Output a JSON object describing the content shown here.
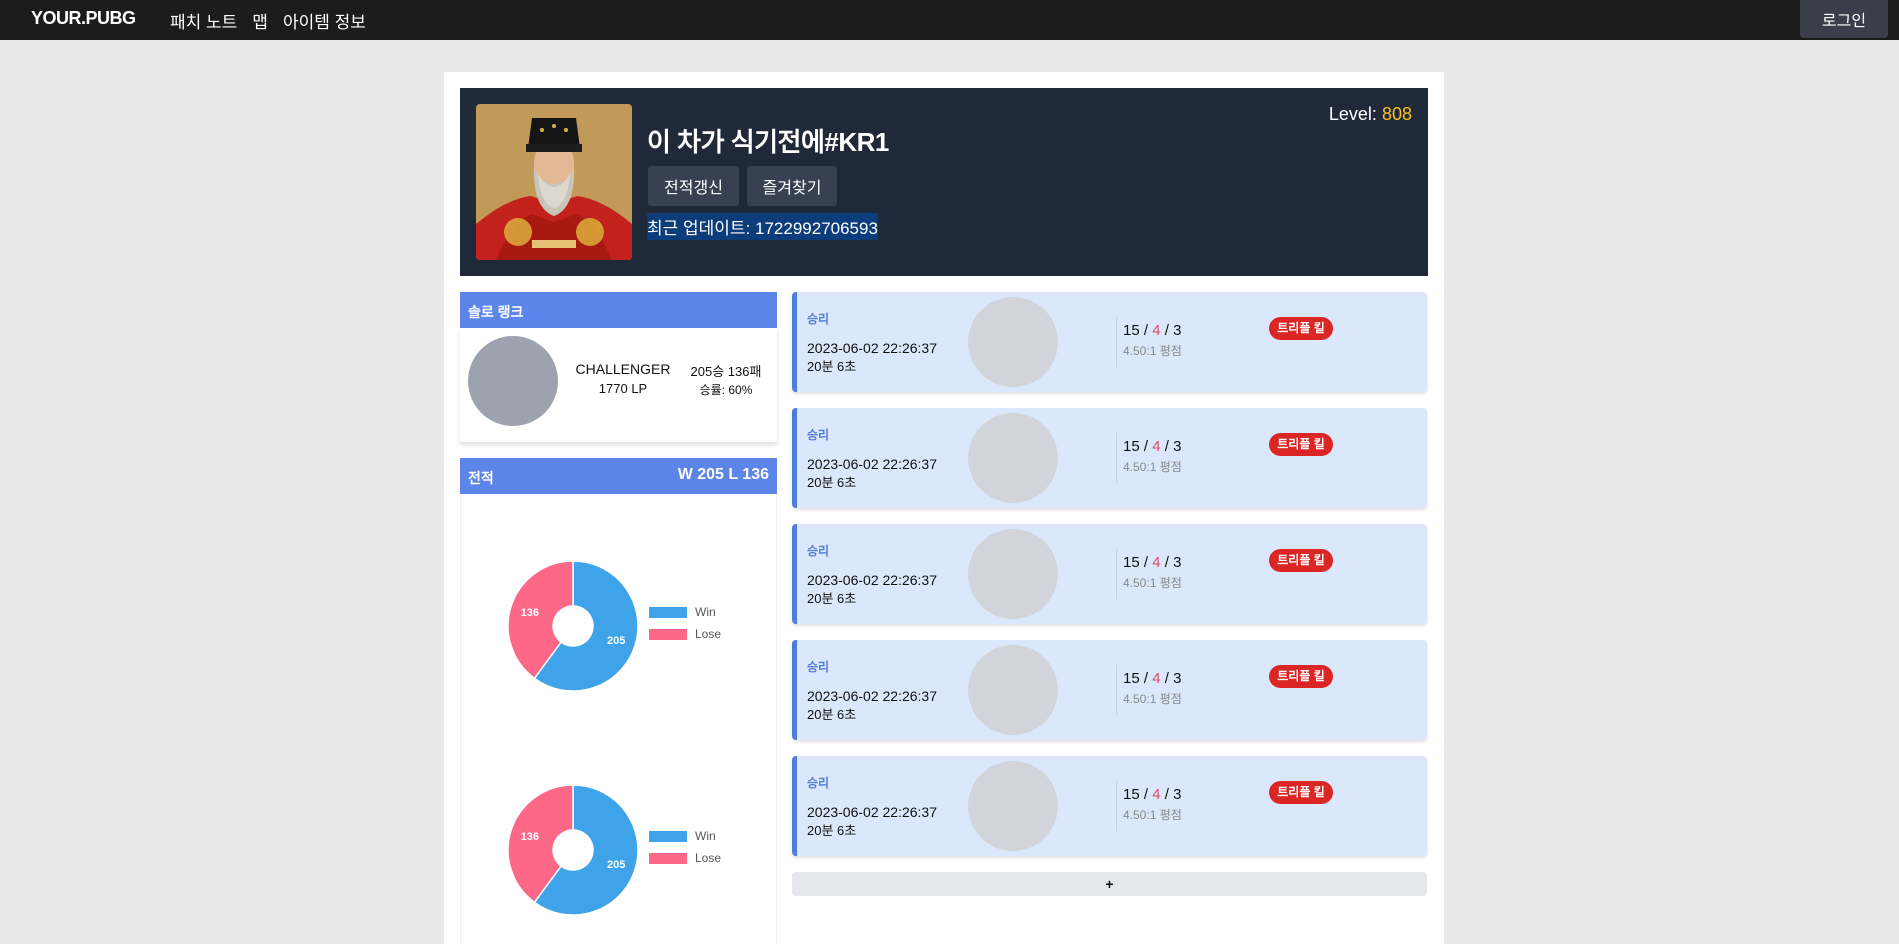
{
  "nav": {
    "brand": "YOUR.PUBG",
    "links": [
      "패치 노트",
      "맵",
      "아이템 정보"
    ],
    "login": "로그인"
  },
  "profile": {
    "name": "이 차가 식기전에#KR1",
    "refresh": "전적갱신",
    "favorite": "즐겨찾기",
    "updated": "최근 업데이트: 1722992706593",
    "level_label": "Level:",
    "level": "808"
  },
  "solo": {
    "title": "솔로 랭크",
    "tier": "CHALLENGER",
    "lp": "1770 LP",
    "record": "205승 136패",
    "winrate": "승률: 60%"
  },
  "stats": {
    "title": "전적",
    "summary": "W 205  L 136"
  },
  "chart_data": [
    {
      "type": "pie",
      "categories": [
        "Win",
        "Lose"
      ],
      "values": [
        205,
        136
      ],
      "colors": [
        "#3ea3e8",
        "#fc6886"
      ],
      "legend": "right"
    },
    {
      "type": "pie",
      "categories": [
        "Win",
        "Lose"
      ],
      "values": [
        205,
        136
      ],
      "colors": [
        "#3ea3e8",
        "#fc6886"
      ],
      "legend": "right"
    }
  ],
  "matches": [
    {
      "result": "승리",
      "date": "2023-06-02 22:26:37",
      "duration": "20분 6초",
      "k": "15",
      "d": "4",
      "a": "3",
      "ratio": "4.50:1 평점",
      "badge": "트리플 킬"
    },
    {
      "result": "승리",
      "date": "2023-06-02 22:26:37",
      "duration": "20분 6초",
      "k": "15",
      "d": "4",
      "a": "3",
      "ratio": "4.50:1 평점",
      "badge": "트리플 킬"
    },
    {
      "result": "승리",
      "date": "2023-06-02 22:26:37",
      "duration": "20분 6초",
      "k": "15",
      "d": "4",
      "a": "3",
      "ratio": "4.50:1 평점",
      "badge": "트리플 킬"
    },
    {
      "result": "승리",
      "date": "2023-06-02 22:26:37",
      "duration": "20분 6초",
      "k": "15",
      "d": "4",
      "a": "3",
      "ratio": "4.50:1 평점",
      "badge": "트리플 킬"
    },
    {
      "result": "승리",
      "date": "2023-06-02 22:26:37",
      "duration": "20분 6초",
      "k": "15",
      "d": "4",
      "a": "3",
      "ratio": "4.50:1 평점",
      "badge": "트리플 킬"
    }
  ],
  "more": "+"
}
